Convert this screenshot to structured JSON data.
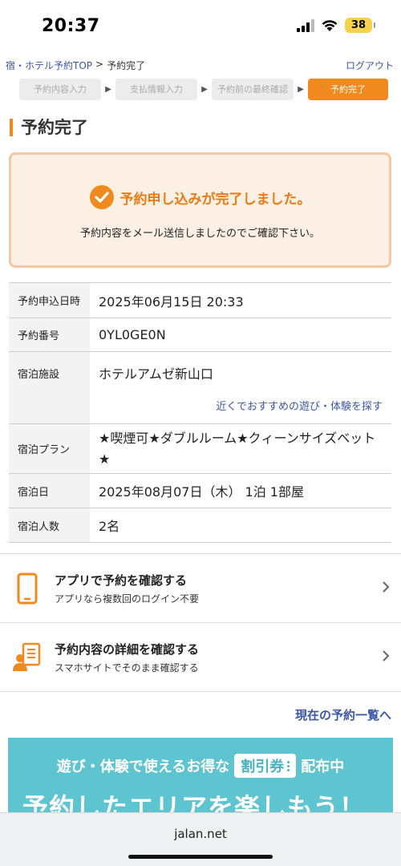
{
  "status_bar": {
    "time": "20:37",
    "battery": "38"
  },
  "breadcrumb": {
    "home": "宿・ホテル予約TOP",
    "separator": ">",
    "current": "予約完了"
  },
  "logout": "ログアウト",
  "steps": [
    {
      "label": "予約内容入力"
    },
    {
      "label": "支払情報入力"
    },
    {
      "label": "予約前の最終確認"
    },
    {
      "label": "予約完了"
    }
  ],
  "title": "予約完了",
  "complete": {
    "message": "予約申し込みが完了しました。",
    "sub": "予約内容をメール送信しましたのでご確認下さい。"
  },
  "details": {
    "date": {
      "label": "予約申込日時",
      "value": "2025年06月15日 20:33"
    },
    "number": {
      "label": "予約番号",
      "value": "0YL0GE0N"
    },
    "facility": {
      "label": "宿泊施設",
      "value": "ホテルアムゼ新山口",
      "link": "近くでおすすめの遊び・体験を探す"
    },
    "plan": {
      "label": "宿泊プラン",
      "value": "★喫煙可★ダブルルーム★クィーンサイズベット★"
    },
    "stay": {
      "label": "宿泊日",
      "value": "2025年08月07日（木） 1泊 1部屋"
    },
    "guests": {
      "label": "宿泊人数",
      "value": "2名"
    }
  },
  "actions": [
    {
      "title": "アプリで予約を確認する",
      "sub": "アプリなら複数回のログイン不要",
      "icon": "smartphone-icon"
    },
    {
      "title": "予約内容の詳細を確認する",
      "sub": "スマホサイトでそのまま確認する",
      "icon": "person-document-icon"
    }
  ],
  "list_link": "現在の予約一覧へ",
  "banner": {
    "line1_pre": "遊び・体験で使えるお得な",
    "coupon": "割引券",
    "line1_post": "配布中",
    "line2": "予約したエリアを楽しもう！"
  },
  "browser": {
    "url": "jalan.net"
  },
  "colors": {
    "accent": "#f08a1e",
    "link": "#3a57a7",
    "banner": "#5ec4cf"
  }
}
